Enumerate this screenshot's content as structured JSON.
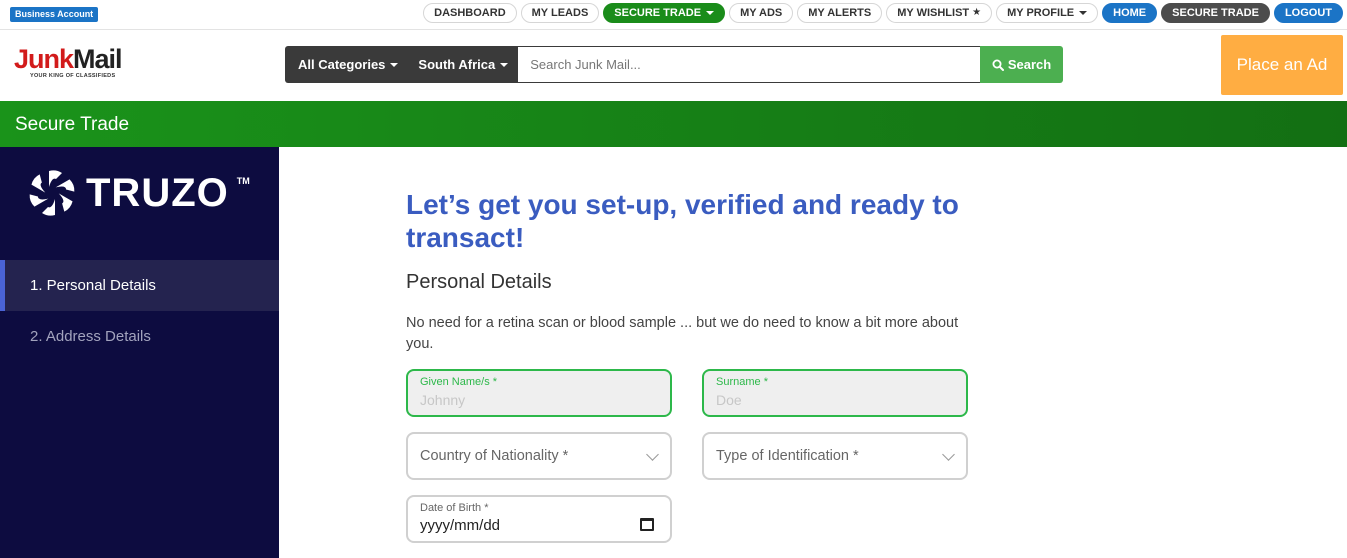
{
  "topbar": {
    "business_badge": "Business Account",
    "nav": {
      "dashboard": "DASHBOARD",
      "my_leads": "MY LEADS",
      "secure_trade_menu": "SECURE TRADE",
      "my_ads": "MY ADS",
      "my_alerts": "MY ALERTS",
      "my_wishlist": "MY WISHLIST",
      "my_profile": "MY PROFILE",
      "home": "HOME",
      "secure_trade": "SECURE TRADE",
      "logout": "LOGOUT"
    },
    "colors": {
      "green": "#1a8c1a",
      "blue": "#1b74c6",
      "grey": "#4c4c4c"
    }
  },
  "header": {
    "logo_junk": "Junk",
    "logo_mail": "Mail",
    "logo_tagline": "YOUR KING OF CLASSIFIEDS",
    "categories_label": "All Categories",
    "region_label": "South Africa",
    "search_placeholder": "Search Junk Mail...",
    "search_button": "Search",
    "place_ad": "Place an Ad"
  },
  "banner": {
    "title": "Secure Trade"
  },
  "sidebar": {
    "brand": "TRUZO",
    "brand_tm": "TM",
    "steps": [
      {
        "label": "1.   Personal Details",
        "active": true
      },
      {
        "label": "2.   Address Details",
        "active": false
      }
    ]
  },
  "form": {
    "heading": "Let’s get you set-up, verified and ready to transact!",
    "section_title": "Personal Details",
    "intro": "No need for a retina scan or blood sample ... but we do need to know a bit more about you.",
    "given_name": {
      "label": "Given Name/s *",
      "value": "Johnny"
    },
    "surname": {
      "label": "Surname *",
      "value": "Doe"
    },
    "nationality": {
      "label": "Country of Nationality *"
    },
    "id_type": {
      "label": "Type of Identification *"
    },
    "dob": {
      "label": "Date of Birth *",
      "value": "yyyy/mm/dd"
    }
  }
}
